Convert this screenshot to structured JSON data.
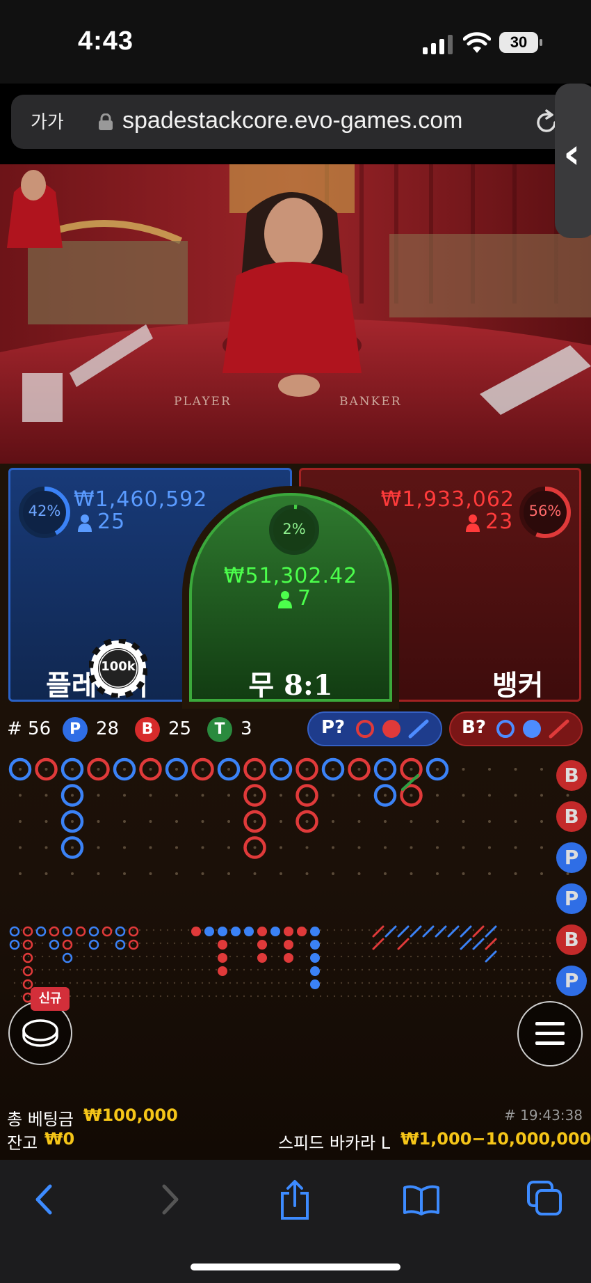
{
  "status": {
    "time": "4:43",
    "battery": "30"
  },
  "browser": {
    "aa": "가가",
    "url": "spadestackcore.evo-games.com"
  },
  "table_print": {
    "player": "PLAYER",
    "banker": "BANKER"
  },
  "player": {
    "pct": "42%",
    "amount": "₩1,460,592",
    "count": "25",
    "label": "플레이어",
    "pct_value": 0.42
  },
  "tie": {
    "pct": "2%",
    "amount": "₩51,302.42",
    "count": "7",
    "label": "무 8:1",
    "pct_value": 0.02
  },
  "banker": {
    "pct": "56%",
    "amount": "₩1,933,062",
    "count": "23",
    "label": "뱅커",
    "pct_value": 0.56
  },
  "chip": {
    "label": "100k"
  },
  "stats": {
    "hash": "# 56",
    "p_badge": "P",
    "p_count": "28",
    "b_badge": "B",
    "b_count": "25",
    "t_badge": "T",
    "t_count": "3",
    "p_ask": "P?",
    "b_ask": "B?"
  },
  "side_beads": [
    "B",
    "B",
    "P",
    "P",
    "B",
    "P"
  ],
  "new_badge": "신규",
  "footer": {
    "total_bet_label": "총 베팅금",
    "total_bet": "₩100,000",
    "balance_label": "잔고",
    "balance": "₩0",
    "round_time": "# 19:43:38",
    "table_name": "스피드 바카라 L",
    "limits": "₩1,000−10,000,000"
  },
  "colors": {
    "player": "#3b82f6",
    "banker": "#e03a3a",
    "tie": "#2ea043",
    "gold": "#f5c518"
  },
  "big_road": [
    {
      "col": 0,
      "row": 0,
      "c": "P"
    },
    {
      "col": 1,
      "row": 0,
      "c": "B"
    },
    {
      "col": 2,
      "row": 0,
      "c": "P"
    },
    {
      "col": 2,
      "row": 1,
      "c": "P"
    },
    {
      "col": 2,
      "row": 2,
      "c": "P"
    },
    {
      "col": 2,
      "row": 3,
      "c": "P"
    },
    {
      "col": 3,
      "row": 0,
      "c": "B"
    },
    {
      "col": 4,
      "row": 0,
      "c": "P"
    },
    {
      "col": 5,
      "row": 0,
      "c": "B"
    },
    {
      "col": 6,
      "row": 0,
      "c": "P"
    },
    {
      "col": 7,
      "row": 0,
      "c": "B"
    },
    {
      "col": 8,
      "row": 0,
      "c": "P"
    },
    {
      "col": 9,
      "row": 0,
      "c": "B"
    },
    {
      "col": 9,
      "row": 1,
      "c": "B"
    },
    {
      "col": 9,
      "row": 2,
      "c": "B"
    },
    {
      "col": 9,
      "row": 3,
      "c": "B"
    },
    {
      "col": 10,
      "row": 0,
      "c": "P"
    },
    {
      "col": 11,
      "row": 0,
      "c": "B"
    },
    {
      "col": 11,
      "row": 1,
      "c": "B"
    },
    {
      "col": 11,
      "row": 2,
      "c": "B"
    },
    {
      "col": 12,
      "row": 0,
      "c": "P"
    },
    {
      "col": 13,
      "row": 0,
      "c": "B"
    },
    {
      "col": 14,
      "row": 0,
      "c": "P"
    },
    {
      "col": 14,
      "row": 1,
      "c": "P"
    },
    {
      "col": 15,
      "row": 0,
      "c": "B"
    },
    {
      "col": 15,
      "row": 1,
      "c": "B"
    },
    {
      "col": 16,
      "row": 0,
      "c": "P"
    }
  ]
}
